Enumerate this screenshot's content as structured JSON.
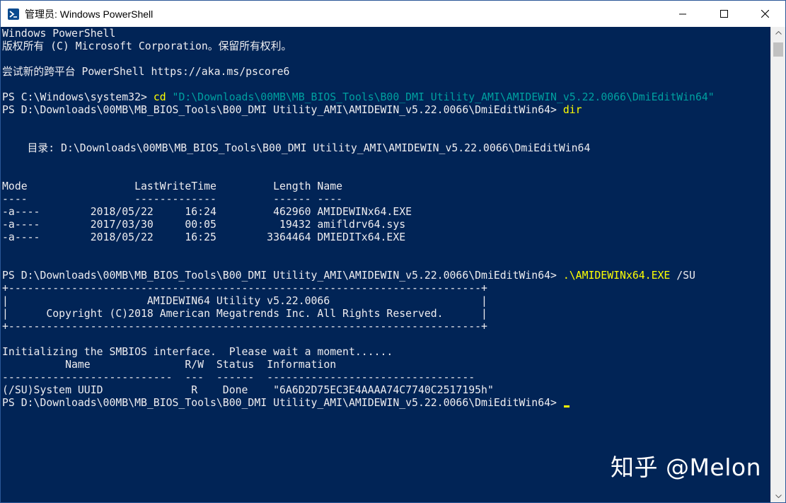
{
  "window": {
    "title": "管理员: Windows PowerShell",
    "icon": "powershell-icon",
    "controls": [
      "minimize-icon",
      "maximize-icon",
      "close-icon"
    ]
  },
  "terminal": {
    "lines": [
      {
        "segments": [
          {
            "text": "Windows PowerShell",
            "style": "out"
          }
        ]
      },
      {
        "segments": [
          {
            "text": "版权所有 (C) Microsoft Corporation。保留所有权利。",
            "style": "out"
          }
        ]
      },
      {
        "segments": [
          {
            "text": "",
            "style": "out"
          }
        ]
      },
      {
        "segments": [
          {
            "text": "尝试新的跨平台 PowerShell https://aka.ms/pscore6",
            "style": "out"
          }
        ]
      },
      {
        "segments": [
          {
            "text": "",
            "style": "out"
          }
        ]
      },
      {
        "segments": [
          {
            "text": "PS C:\\Windows\\system32> ",
            "style": "out"
          },
          {
            "text": "cd",
            "style": "cmd"
          },
          {
            "text": " \"D:\\Downloads\\00MB\\MB_BIOS_Tools\\B00_DMI Utility_AMI\\AMIDEWIN_v5.22.0066\\DmiEditWin64\"",
            "style": "str"
          }
        ]
      },
      {
        "segments": [
          {
            "text": "PS D:\\Downloads\\00MB\\MB_BIOS_Tools\\B00_DMI Utility_AMI\\AMIDEWIN_v5.22.0066\\DmiEditWin64> ",
            "style": "out"
          },
          {
            "text": "dir",
            "style": "cmd"
          }
        ]
      },
      {
        "segments": [
          {
            "text": "",
            "style": "out"
          }
        ]
      },
      {
        "segments": [
          {
            "text": "",
            "style": "out"
          }
        ]
      },
      {
        "segments": [
          {
            "text": "    目录: D:\\Downloads\\00MB\\MB_BIOS_Tools\\B00_DMI Utility_AMI\\AMIDEWIN_v5.22.0066\\DmiEditWin64",
            "style": "out"
          }
        ]
      },
      {
        "segments": [
          {
            "text": "",
            "style": "out"
          }
        ]
      },
      {
        "segments": [
          {
            "text": "",
            "style": "out"
          }
        ]
      },
      {
        "segments": [
          {
            "text": "Mode                 LastWriteTime         Length Name",
            "style": "out"
          }
        ]
      },
      {
        "segments": [
          {
            "text": "----                 -------------         ------ ----",
            "style": "out"
          }
        ]
      },
      {
        "segments": [
          {
            "text": "-a----        2018/05/22     16:24         462960 AMIDEWINx64.EXE",
            "style": "out"
          }
        ]
      },
      {
        "segments": [
          {
            "text": "-a----        2017/03/30     00:05          19432 amifldrv64.sys",
            "style": "out"
          }
        ]
      },
      {
        "segments": [
          {
            "text": "-a----        2018/05/22     16:25        3364464 DMIEDITx64.EXE",
            "style": "out"
          }
        ]
      },
      {
        "segments": [
          {
            "text": "",
            "style": "out"
          }
        ]
      },
      {
        "segments": [
          {
            "text": "",
            "style": "out"
          }
        ]
      },
      {
        "segments": [
          {
            "text": "PS D:\\Downloads\\00MB\\MB_BIOS_Tools\\B00_DMI Utility_AMI\\AMIDEWIN_v5.22.0066\\DmiEditWin64> ",
            "style": "out"
          },
          {
            "text": ".\\AMIDEWINx64.EXE",
            "style": "cmd"
          },
          {
            "text": " /SU",
            "style": "out"
          }
        ]
      },
      {
        "segments": [
          {
            "text": "+---------------------------------------------------------------------------+",
            "style": "out"
          }
        ]
      },
      {
        "segments": [
          {
            "text": "|                      AMIDEWIN64 Utility v5.22.0066                        |",
            "style": "out"
          }
        ]
      },
      {
        "segments": [
          {
            "text": "|      Copyright (C)2018 American Megatrends Inc. All Rights Reserved.      |",
            "style": "out"
          }
        ]
      },
      {
        "segments": [
          {
            "text": "+---------------------------------------------------------------------------+",
            "style": "out"
          }
        ]
      },
      {
        "segments": [
          {
            "text": "",
            "style": "out"
          }
        ]
      },
      {
        "segments": [
          {
            "text": "Initializing the SMBIOS interface.  Please wait a moment......",
            "style": "out"
          }
        ]
      },
      {
        "segments": [
          {
            "text": "          Name               R/W  Status  Information",
            "style": "out"
          }
        ]
      },
      {
        "segments": [
          {
            "text": "---------------------------  ---  ------  ---------------------------------",
            "style": "out"
          }
        ]
      },
      {
        "segments": [
          {
            "text": "(/SU)System UUID              R    Done    \"6A6D2D75EC3E4AAAA74C7740C2517195h\"",
            "style": "out"
          }
        ]
      },
      {
        "segments": [
          {
            "text": "PS D:\\Downloads\\00MB\\MB_BIOS_Tools\\B00_DMI Utility_AMI\\AMIDEWIN_v5.22.0066\\DmiEditWin64> ",
            "style": "out"
          }
        ],
        "cursor": true
      }
    ]
  },
  "watermark": "知乎 @Melon",
  "colors": {
    "background": "#012456",
    "text": "#eeedf0",
    "command": "#ffff00",
    "string": "#00a0a0"
  }
}
